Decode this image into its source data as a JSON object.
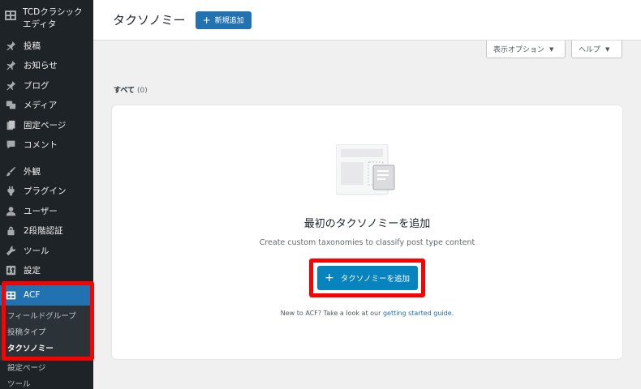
{
  "sidebar": {
    "brand_label": "TCDクラシックエディタ",
    "items": [
      {
        "label": "投稿",
        "icon": "pin-icon"
      },
      {
        "label": "お知らせ",
        "icon": "pin-icon"
      },
      {
        "label": "ブログ",
        "icon": "pin-icon"
      },
      {
        "label": "メディア",
        "icon": "media-icon"
      },
      {
        "label": "固定ページ",
        "icon": "page-icon"
      },
      {
        "label": "コメント",
        "icon": "comment-icon"
      },
      {
        "label": "外観",
        "icon": "brush-icon"
      },
      {
        "label": "プラグイン",
        "icon": "plugin-icon"
      },
      {
        "label": "ユーザー",
        "icon": "user-icon"
      },
      {
        "label": "2段階認証",
        "icon": "lock-icon"
      },
      {
        "label": "ツール",
        "icon": "wrench-icon"
      },
      {
        "label": "設定",
        "icon": "settings-icon"
      },
      {
        "label": "ACF",
        "icon": "acf-icon"
      }
    ],
    "acf_submenu": [
      "フィールドグループ",
      "投稿タイプ",
      "タクソノミー"
    ],
    "after_submenu": [
      "設定ページ",
      "ツール"
    ]
  },
  "header": {
    "title": "タクソノミー",
    "add_new_label": "新規追加"
  },
  "screen_options": {
    "display_label": "表示オプション",
    "help_label": "ヘルプ"
  },
  "filter": {
    "all_label": "すべて",
    "count": "(0)"
  },
  "empty_state": {
    "title": "最初のタクソノミーを追加",
    "description": "Create custom taxonomies to classify post type content",
    "button_label": "タクソノミーを追加",
    "help_prefix": "New to ACF? Take a look at our",
    "help_link": "getting started guide",
    "help_suffix": "."
  },
  "colors": {
    "sidebar_bg": "#1d2327",
    "accent": "#2271b1",
    "highlight": "#ff0000"
  }
}
